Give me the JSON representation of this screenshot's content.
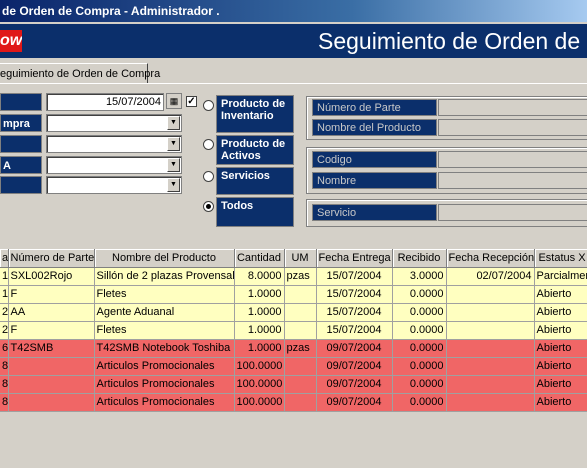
{
  "window": {
    "title": "de Orden de Compra - Administrador ."
  },
  "banner": {
    "logo_text": "ow",
    "title": "Seguimiento de Orden de C"
  },
  "tab": {
    "label": "eguimiento de Orden de Compra"
  },
  "filters": {
    "labels": [
      "",
      "mpra",
      "",
      "A",
      ""
    ],
    "date_value": "15/07/2004",
    "date_checked": "✓"
  },
  "options": [
    {
      "label": "Producto de Inventario",
      "selected": false
    },
    {
      "label": "Producto de Activos",
      "selected": false
    },
    {
      "label": "Servicios",
      "selected": false
    },
    {
      "label": "Todos",
      "selected": true
    }
  ],
  "groups": {
    "numero_parte": "Número de Parte",
    "nombre_producto": "Nombre del Producto",
    "codigo": "Codigo",
    "nombre": "Nombre",
    "servicio": "Servicio"
  },
  "table": {
    "columns": [
      "a",
      "Número de Parte",
      "Nombre del Producto",
      "Cantidad",
      "UM",
      "Fecha Entrega",
      "Recibido",
      "Fecha Recepción",
      "Estatus X"
    ],
    "rows": [
      {
        "color": "#ffffc0",
        "cells": [
          "1",
          "SXL002Rojo",
          "Sillón de 2 plazas Provensal V",
          "8.0000",
          "pzas",
          "15/07/2004",
          "3.0000",
          "02/07/2004",
          "Parcialmer"
        ]
      },
      {
        "color": "#ffffc0",
        "cells": [
          "1",
          "F",
          "Fletes",
          "1.0000",
          "",
          "15/07/2004",
          "0.0000",
          "",
          "Abierto"
        ]
      },
      {
        "color": "#ffffc0",
        "cells": [
          "2",
          "AA",
          "Agente Aduanal",
          "1.0000",
          "",
          "15/07/2004",
          "0.0000",
          "",
          "Abierto"
        ]
      },
      {
        "color": "#ffffc0",
        "cells": [
          "2",
          "F",
          "Fletes",
          "1.0000",
          "",
          "15/07/2004",
          "0.0000",
          "",
          "Abierto"
        ]
      },
      {
        "color": "#f06666",
        "cells": [
          "6",
          "T42SMB",
          "T42SMB Notebook Toshiba",
          "1.0000",
          "pzas",
          "09/07/2004",
          "0.0000",
          "",
          "Abierto"
        ]
      },
      {
        "color": "#f06666",
        "cells": [
          "8",
          "",
          "Articulos Promocionales",
          "100.0000",
          "",
          "09/07/2004",
          "0.0000",
          "",
          "Abierto"
        ]
      },
      {
        "color": "#f06666",
        "cells": [
          "8",
          "",
          "Articulos Promocionales",
          "100.0000",
          "",
          "09/07/2004",
          "0.0000",
          "",
          "Abierto"
        ]
      },
      {
        "color": "#f06666",
        "cells": [
          "8",
          "",
          "Articulos Promocionales",
          "100.0000",
          "",
          "09/07/2004",
          "0.0000",
          "",
          "Abierto"
        ]
      }
    ]
  }
}
